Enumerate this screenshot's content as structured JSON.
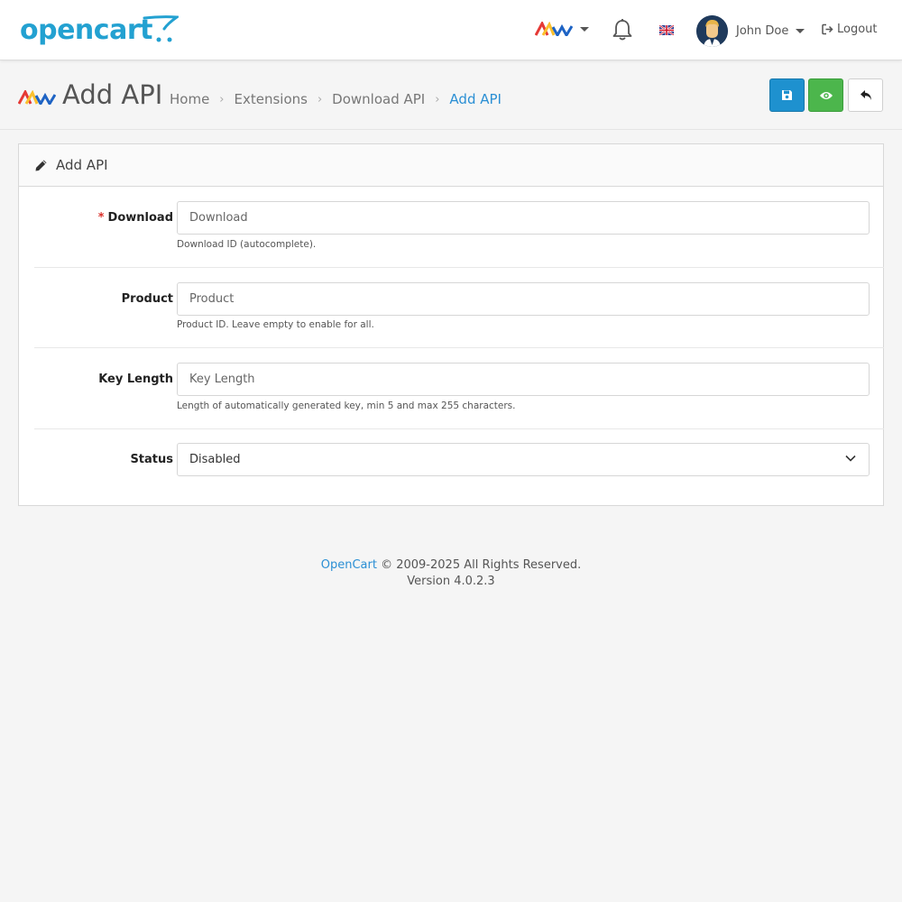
{
  "header": {
    "logo_text": "opencart",
    "user_name": "John Doe",
    "logout_label": "Logout"
  },
  "page": {
    "title": "Add API",
    "breadcrumb": [
      "Home",
      "Extensions",
      "Download API",
      "Add API"
    ]
  },
  "card": {
    "title": "Add API"
  },
  "form": {
    "download": {
      "label": "Download",
      "placeholder": "Download",
      "help": "Download ID (autocomplete)."
    },
    "product": {
      "label": "Product",
      "placeholder": "Product",
      "help": "Product ID. Leave empty to enable for all."
    },
    "key_length": {
      "label": "Key Length",
      "placeholder": "Key Length",
      "help": "Length of automatically generated key, min 5 and max 255 characters."
    },
    "status": {
      "label": "Status",
      "value": "Disabled"
    }
  },
  "footer": {
    "brand": "OpenCart",
    "copyright": "© 2009-2025 All Rights Reserved.",
    "version": "Version 4.0.2.3"
  },
  "colors": {
    "brand": "#23a1d1",
    "primary": "#1e91cf",
    "success": "#4cb64c",
    "link": "#2b8fd4",
    "required": "#d9302a"
  },
  "icons": {
    "save": "save-icon",
    "view": "eye-icon",
    "back": "reply-icon",
    "edit": "pencil-icon",
    "bell": "bell-icon",
    "logout": "sign-out-icon"
  }
}
